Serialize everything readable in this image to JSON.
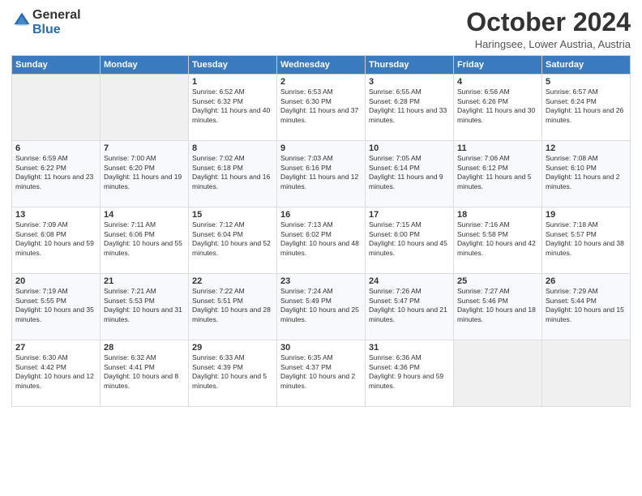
{
  "header": {
    "logo_general": "General",
    "logo_blue": "Blue",
    "month": "October 2024",
    "location": "Haringsee, Lower Austria, Austria"
  },
  "weekdays": [
    "Sunday",
    "Monday",
    "Tuesday",
    "Wednesday",
    "Thursday",
    "Friday",
    "Saturday"
  ],
  "weeks": [
    [
      {
        "day": "",
        "info": ""
      },
      {
        "day": "",
        "info": ""
      },
      {
        "day": "1",
        "info": "Sunrise: 6:52 AM\nSunset: 6:32 PM\nDaylight: 11 hours and 40 minutes."
      },
      {
        "day": "2",
        "info": "Sunrise: 6:53 AM\nSunset: 6:30 PM\nDaylight: 11 hours and 37 minutes."
      },
      {
        "day": "3",
        "info": "Sunrise: 6:55 AM\nSunset: 6:28 PM\nDaylight: 11 hours and 33 minutes."
      },
      {
        "day": "4",
        "info": "Sunrise: 6:56 AM\nSunset: 6:26 PM\nDaylight: 11 hours and 30 minutes."
      },
      {
        "day": "5",
        "info": "Sunrise: 6:57 AM\nSunset: 6:24 PM\nDaylight: 11 hours and 26 minutes."
      }
    ],
    [
      {
        "day": "6",
        "info": "Sunrise: 6:59 AM\nSunset: 6:22 PM\nDaylight: 11 hours and 23 minutes."
      },
      {
        "day": "7",
        "info": "Sunrise: 7:00 AM\nSunset: 6:20 PM\nDaylight: 11 hours and 19 minutes."
      },
      {
        "day": "8",
        "info": "Sunrise: 7:02 AM\nSunset: 6:18 PM\nDaylight: 11 hours and 16 minutes."
      },
      {
        "day": "9",
        "info": "Sunrise: 7:03 AM\nSunset: 6:16 PM\nDaylight: 11 hours and 12 minutes."
      },
      {
        "day": "10",
        "info": "Sunrise: 7:05 AM\nSunset: 6:14 PM\nDaylight: 11 hours and 9 minutes."
      },
      {
        "day": "11",
        "info": "Sunrise: 7:06 AM\nSunset: 6:12 PM\nDaylight: 11 hours and 5 minutes."
      },
      {
        "day": "12",
        "info": "Sunrise: 7:08 AM\nSunset: 6:10 PM\nDaylight: 11 hours and 2 minutes."
      }
    ],
    [
      {
        "day": "13",
        "info": "Sunrise: 7:09 AM\nSunset: 6:08 PM\nDaylight: 10 hours and 59 minutes."
      },
      {
        "day": "14",
        "info": "Sunrise: 7:11 AM\nSunset: 6:06 PM\nDaylight: 10 hours and 55 minutes."
      },
      {
        "day": "15",
        "info": "Sunrise: 7:12 AM\nSunset: 6:04 PM\nDaylight: 10 hours and 52 minutes."
      },
      {
        "day": "16",
        "info": "Sunrise: 7:13 AM\nSunset: 6:02 PM\nDaylight: 10 hours and 48 minutes."
      },
      {
        "day": "17",
        "info": "Sunrise: 7:15 AM\nSunset: 6:00 PM\nDaylight: 10 hours and 45 minutes."
      },
      {
        "day": "18",
        "info": "Sunrise: 7:16 AM\nSunset: 5:58 PM\nDaylight: 10 hours and 42 minutes."
      },
      {
        "day": "19",
        "info": "Sunrise: 7:18 AM\nSunset: 5:57 PM\nDaylight: 10 hours and 38 minutes."
      }
    ],
    [
      {
        "day": "20",
        "info": "Sunrise: 7:19 AM\nSunset: 5:55 PM\nDaylight: 10 hours and 35 minutes."
      },
      {
        "day": "21",
        "info": "Sunrise: 7:21 AM\nSunset: 5:53 PM\nDaylight: 10 hours and 31 minutes."
      },
      {
        "day": "22",
        "info": "Sunrise: 7:22 AM\nSunset: 5:51 PM\nDaylight: 10 hours and 28 minutes."
      },
      {
        "day": "23",
        "info": "Sunrise: 7:24 AM\nSunset: 5:49 PM\nDaylight: 10 hours and 25 minutes."
      },
      {
        "day": "24",
        "info": "Sunrise: 7:26 AM\nSunset: 5:47 PM\nDaylight: 10 hours and 21 minutes."
      },
      {
        "day": "25",
        "info": "Sunrise: 7:27 AM\nSunset: 5:46 PM\nDaylight: 10 hours and 18 minutes."
      },
      {
        "day": "26",
        "info": "Sunrise: 7:29 AM\nSunset: 5:44 PM\nDaylight: 10 hours and 15 minutes."
      }
    ],
    [
      {
        "day": "27",
        "info": "Sunrise: 6:30 AM\nSunset: 4:42 PM\nDaylight: 10 hours and 12 minutes."
      },
      {
        "day": "28",
        "info": "Sunrise: 6:32 AM\nSunset: 4:41 PM\nDaylight: 10 hours and 8 minutes."
      },
      {
        "day": "29",
        "info": "Sunrise: 6:33 AM\nSunset: 4:39 PM\nDaylight: 10 hours and 5 minutes."
      },
      {
        "day": "30",
        "info": "Sunrise: 6:35 AM\nSunset: 4:37 PM\nDaylight: 10 hours and 2 minutes."
      },
      {
        "day": "31",
        "info": "Sunrise: 6:36 AM\nSunset: 4:36 PM\nDaylight: 9 hours and 59 minutes."
      },
      {
        "day": "",
        "info": ""
      },
      {
        "day": "",
        "info": ""
      }
    ]
  ]
}
